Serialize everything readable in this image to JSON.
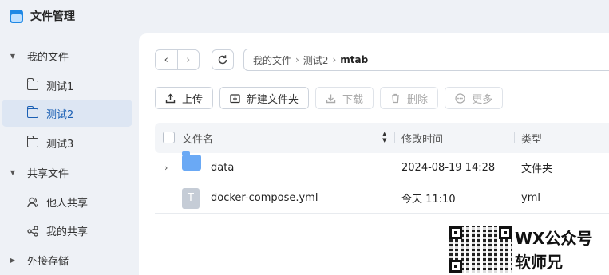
{
  "app": {
    "title": "文件管理"
  },
  "sidebar": {
    "my_files": "我的文件",
    "folders": [
      "测试1",
      "测试2",
      "测试3"
    ],
    "shared_files": "共享文件",
    "shared_items": [
      "他人共享",
      "我的共享"
    ],
    "external_storage": "外接存储"
  },
  "breadcrumb": [
    "我的文件",
    "测试2",
    "mtab"
  ],
  "toolbar": {
    "upload": "上传",
    "new_folder": "新建文件夹",
    "download": "下载",
    "delete": "删除",
    "more": "更多"
  },
  "table": {
    "headers": {
      "name": "文件名",
      "modified": "修改时间",
      "type": "类型"
    },
    "rows": [
      {
        "name": "data",
        "modified": "2024-08-19 14:28",
        "type": "文件夹",
        "icon": "folder-icon"
      },
      {
        "name": "docker-compose.yml",
        "modified": "今天 11:10",
        "type": "yml",
        "icon": "text-file-icon",
        "icon_letter": "T"
      }
    ]
  },
  "watermark": {
    "line1": "WX公众号",
    "line2": "软师兄"
  },
  "colors": {
    "accent": "#1a5fb4",
    "selected_bg": "#dde6f3",
    "folder": "#6aa9f5"
  }
}
